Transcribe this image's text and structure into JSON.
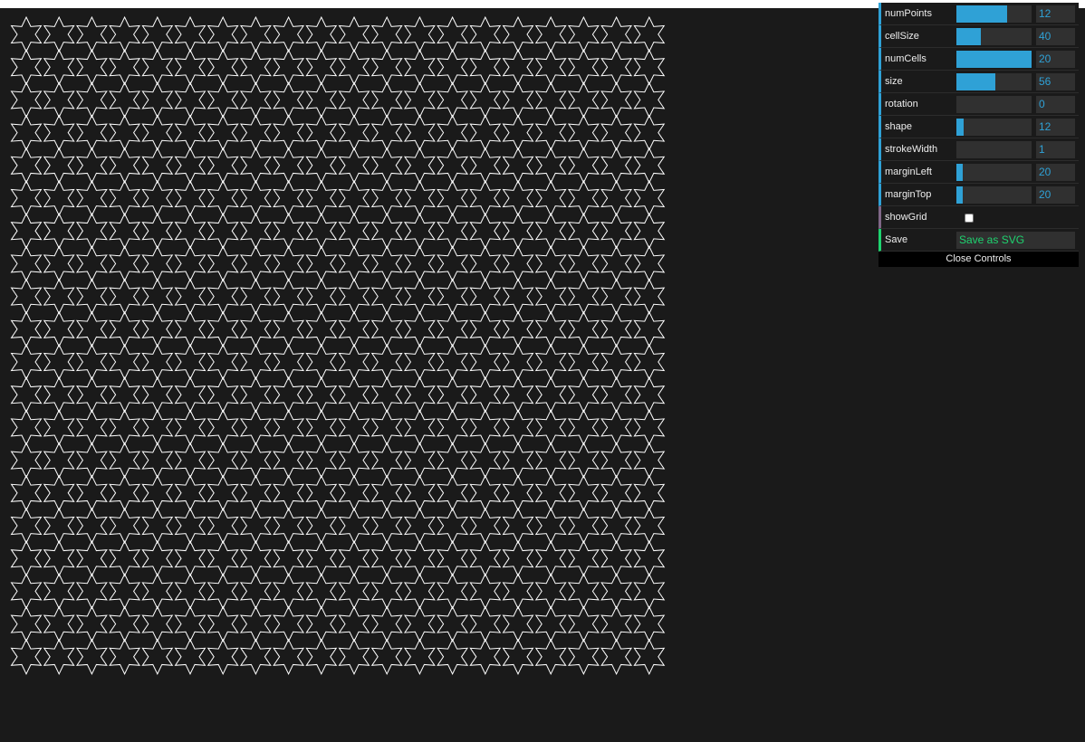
{
  "controls": [
    {
      "label": "numPoints",
      "value": "12",
      "fill": 0.67
    },
    {
      "label": "cellSize",
      "value": "40",
      "fill": 0.33
    },
    {
      "label": "numCells",
      "value": "20",
      "fill": 1.0
    },
    {
      "label": "size",
      "value": "56",
      "fill": 0.52
    },
    {
      "label": "rotation",
      "value": "0",
      "fill": 0.0
    },
    {
      "label": "shape",
      "value": "12",
      "fill": 0.1
    },
    {
      "label": "strokeWidth",
      "value": "1",
      "fill": 0.0
    },
    {
      "label": "marginLeft",
      "value": "20",
      "fill": 0.08
    },
    {
      "label": "marginTop",
      "value": "20",
      "fill": 0.08
    }
  ],
  "showGrid": {
    "label": "showGrid",
    "checked": false
  },
  "save": {
    "label": "Save",
    "button": "Save as SVG"
  },
  "close_label": "Close Controls",
  "colors": {
    "background": "#1a1a1a",
    "stroke": "#ffffff",
    "slider": "#2fa1d6",
    "save_text": "#1ed36f"
  },
  "pattern": {
    "rows": 20,
    "cols": 20,
    "points": 6
  }
}
